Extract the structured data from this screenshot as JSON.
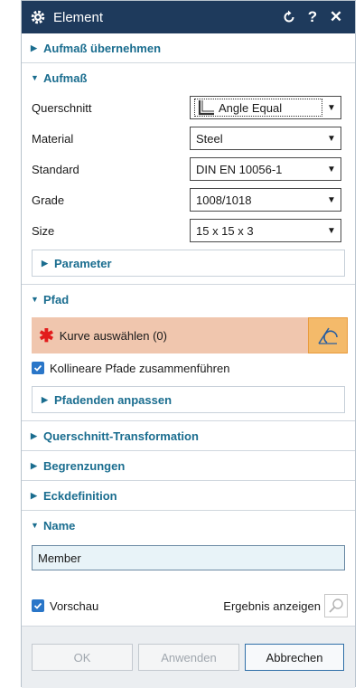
{
  "window": {
    "title": "Element"
  },
  "groups": {
    "aufmass_uebernehmen": "Aufmaß übernehmen",
    "aufmass": "Aufmaß",
    "parameter": "Parameter",
    "pfad": "Pfad",
    "pfadenden": "Pfadenden anpassen",
    "querschnitt_transformation": "Querschnitt-Transformation",
    "begrenzungen": "Begrenzungen",
    "eckdefinition": "Eckdefinition",
    "name": "Name"
  },
  "fields": {
    "querschnitt": {
      "label": "Querschnitt",
      "value": "Angle Equal"
    },
    "material": {
      "label": "Material",
      "value": "Steel"
    },
    "standard": {
      "label": "Standard",
      "value": "DIN EN 10056-1"
    },
    "grade": {
      "label": "Grade",
      "value": "1008/1018"
    },
    "size": {
      "label": "Size",
      "value": "15 x 15 x 3"
    }
  },
  "pfad": {
    "select_curve": "Kurve auswählen (0)",
    "collinear_checkbox": "Kollineare Pfade zusammenführen",
    "collinear_checked": true
  },
  "name": {
    "value": "Member"
  },
  "footer": {
    "preview": "Vorschau",
    "preview_checked": true,
    "show_result": "Ergebnis anzeigen"
  },
  "buttons": {
    "ok": "OK",
    "apply": "Anwenden",
    "cancel": "Abbrechen"
  },
  "colors": {
    "titlebar": "#1e3a5c",
    "group_header": "#1a6d8f",
    "selection_highlight": "#f0c6ae",
    "curve_button": "#f4ba6a",
    "checkbox": "#2a76c8"
  }
}
